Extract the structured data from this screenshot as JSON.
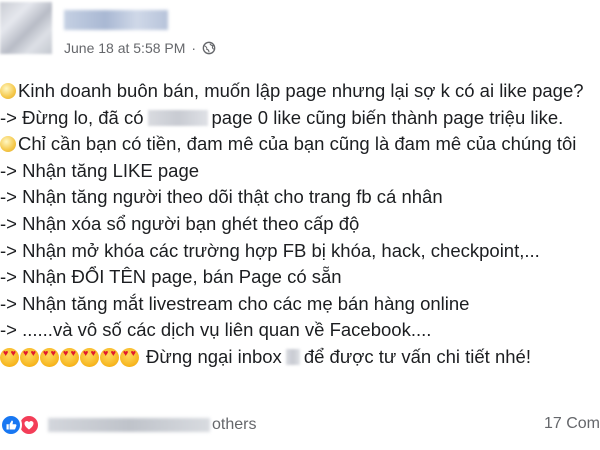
{
  "post": {
    "timestamp": "June 18 at 5:58 PM",
    "separator": "·",
    "privacy_icon": "globe-icon"
  },
  "lines": [
    {
      "prefix_emoji": "smile-emoji",
      "text": "Kinh doanh buôn bán, muốn lập page nhưng lại sợ k có ai like page?"
    },
    {
      "text_a": "-> Đừng lo, đã có",
      "text_b": "page 0 like cũng biến thành page triệu like."
    },
    {
      "prefix_emoji": "smile-emoji",
      "text": "Chỉ cần bạn có tiền, đam mê của bạn cũng là đam mê của chúng tôi"
    },
    {
      "text": "-> Nhận tăng LIKE page"
    },
    {
      "text": "-> Nhận tăng người theo dõi thật cho trang fb cá nhân"
    },
    {
      "text": "-> Nhận xóa sổ người bạn ghét theo cấp độ"
    },
    {
      "text": "-> Nhận mở khóa các trường hợp FB bị khóa, hack, checkpoint,..."
    },
    {
      "text": "-> Nhận ĐỔI TÊN page, bán Page có sẵn"
    },
    {
      "text": "-> Nhận tăng mắt livestream cho các mẹ bán hàng online"
    },
    {
      "text": "-> ......và vô số các dịch vụ liên quan về Facebook...."
    },
    {
      "emoji_count": 7,
      "text_a": "Đừng ngại inbox",
      "text_b": "để được tư vấn chi tiết nhé!"
    }
  ],
  "footer": {
    "reactions": [
      "like-icon",
      "love-icon"
    ],
    "others_text": "others",
    "comments_text": "17 Com",
    "colors": {
      "like": "#1877f2",
      "love": "#f33e58"
    }
  }
}
